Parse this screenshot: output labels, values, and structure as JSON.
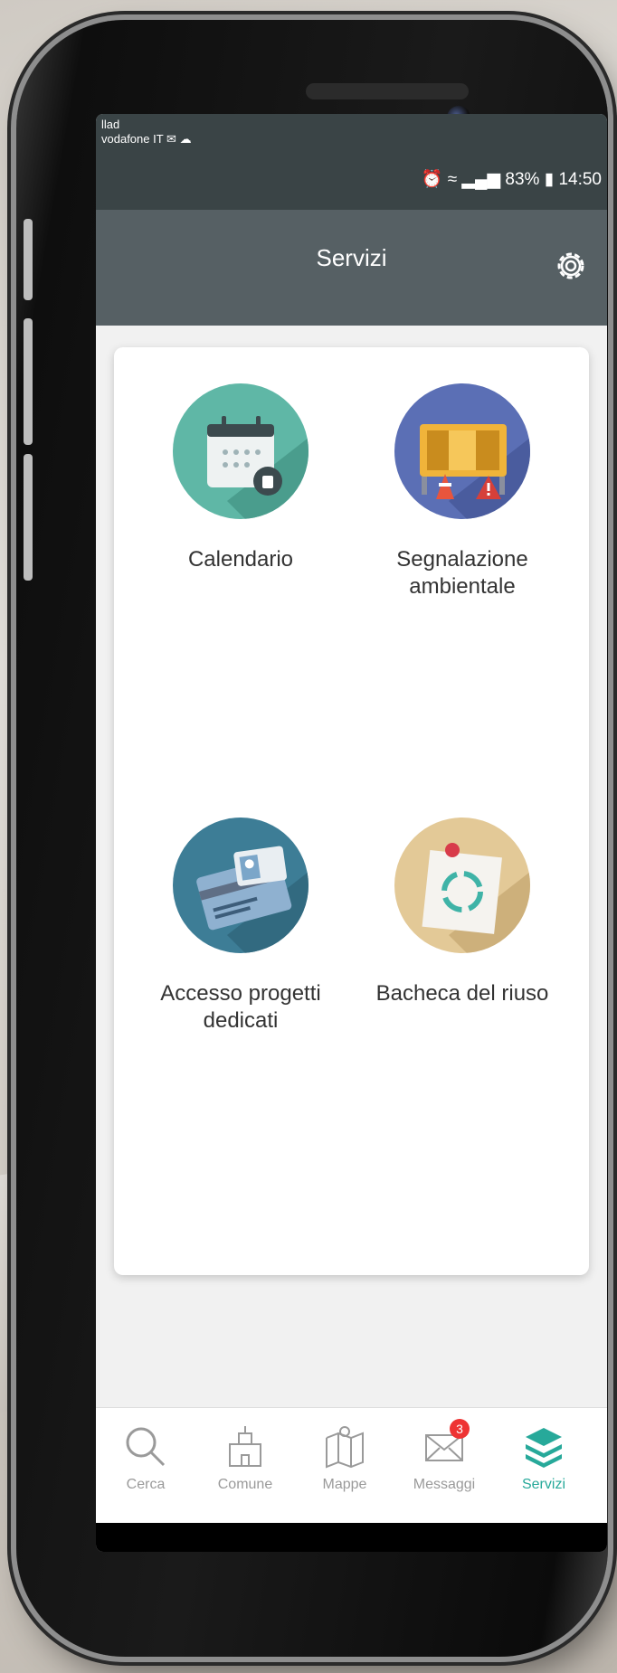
{
  "status_bar": {
    "carrier_line1": "llad",
    "carrier_line2": "vodafone IT",
    "battery": "83%",
    "time": "14:50"
  },
  "header": {
    "title": "Servizi",
    "settings_icon": "gear-icon"
  },
  "services": [
    {
      "label": "Calendario",
      "icon": "calendar-icon",
      "color": "#5fb7a6"
    },
    {
      "label": "Segnalazione ambientale",
      "icon": "road-barrier-icon",
      "color": "#5b6fb5"
    },
    {
      "label": "Accesso progetti dedicati",
      "icon": "id-card-icon",
      "color": "#3d7d96"
    },
    {
      "label": "Bacheca del riuso",
      "icon": "recycle-note-icon",
      "color": "#e3c997"
    }
  ],
  "bottom_nav": [
    {
      "label": "Cerca",
      "icon": "search-icon"
    },
    {
      "label": "Comune",
      "icon": "town-hall-icon"
    },
    {
      "label": "Mappe",
      "icon": "map-icon"
    },
    {
      "label": "Messaggi",
      "icon": "mail-icon",
      "badge": "3"
    },
    {
      "label": "Servizi",
      "icon": "layers-icon",
      "active": true
    }
  ],
  "accent_color": "#27a99a"
}
